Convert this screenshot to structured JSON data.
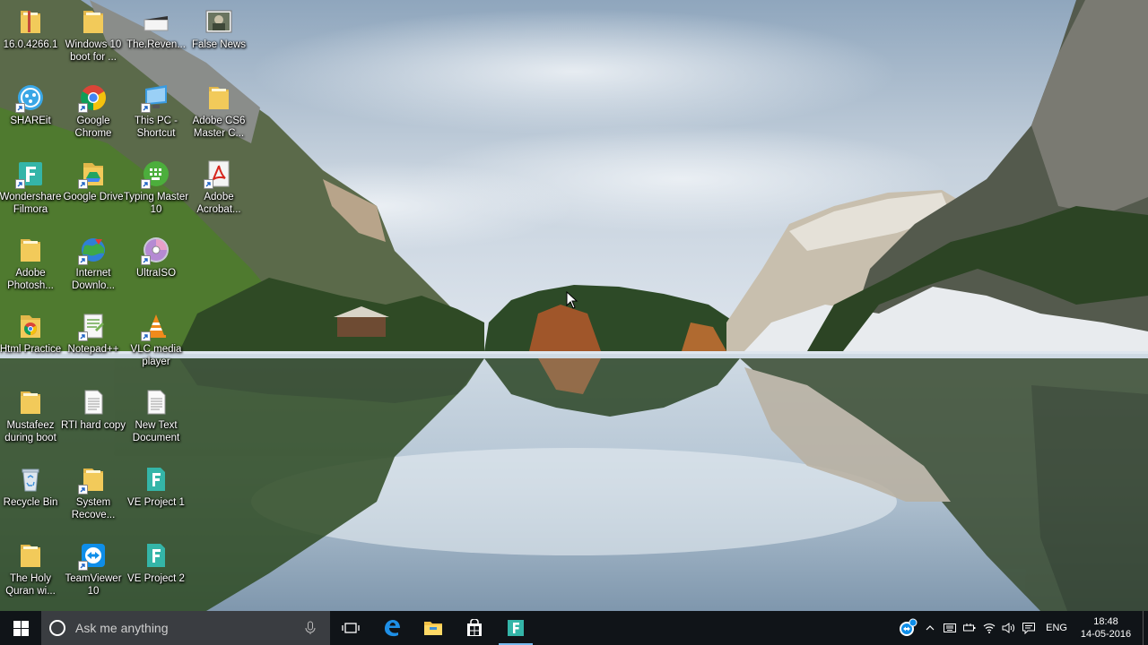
{
  "desktop": {
    "icons": [
      {
        "label": "16.0.4266.1",
        "type": "folder"
      },
      {
        "label": "Windows 10 boot for ...",
        "type": "folder"
      },
      {
        "label": "The.Reven...",
        "type": "video"
      },
      {
        "label": "False News",
        "type": "image"
      },
      {
        "label": "SHAREit",
        "type": "shareit"
      },
      {
        "label": "Google Chrome",
        "type": "chrome"
      },
      {
        "label": "This PC - Shortcut",
        "type": "thispc"
      },
      {
        "label": "Adobe CS6 Master C...",
        "type": "folder"
      },
      {
        "label": "Wondershare Filmora",
        "type": "filmora"
      },
      {
        "label": "Google Drive",
        "type": "gdrive"
      },
      {
        "label": "Typing Master 10",
        "type": "typing"
      },
      {
        "label": "Adobe Acrobat...",
        "type": "acrobat"
      },
      {
        "label": "Adobe Photosh...",
        "type": "folder"
      },
      {
        "label": "Internet Downlo...",
        "type": "idm"
      },
      {
        "label": "UltraISO",
        "type": "disc"
      },
      {
        "label": "Html Practice",
        "type": "folder-chrome"
      },
      {
        "label": "Notepad++",
        "type": "notepad"
      },
      {
        "label": "VLC media player",
        "type": "vlc"
      },
      {
        "label": "Mustafeez during boot",
        "type": "folder"
      },
      {
        "label": "RTI hard copy",
        "type": "doc"
      },
      {
        "label": "New Text Document",
        "type": "doc"
      },
      {
        "label": "Recycle Bin",
        "type": "recycle"
      },
      {
        "label": "System Recove...",
        "type": "folder"
      },
      {
        "label": "VE Project 1",
        "type": "filmora-file"
      },
      {
        "label": "The Holy Quran wi...",
        "type": "folder"
      },
      {
        "label": "TeamViewer 10",
        "type": "teamviewer"
      },
      {
        "label": "VE Project 2",
        "type": "filmora-file"
      }
    ]
  },
  "taskbar": {
    "search_placeholder": "Ask me anything",
    "pinned": [
      "task-view",
      "edge",
      "file-explorer",
      "store",
      "filmora"
    ],
    "tray": {
      "language": "ENG",
      "time": "18:48",
      "date": "14-05-2016"
    }
  },
  "colors": {
    "taskbar_bg": "#101418",
    "search_bg": "#3a3d41",
    "accent": "#76b9ed"
  }
}
